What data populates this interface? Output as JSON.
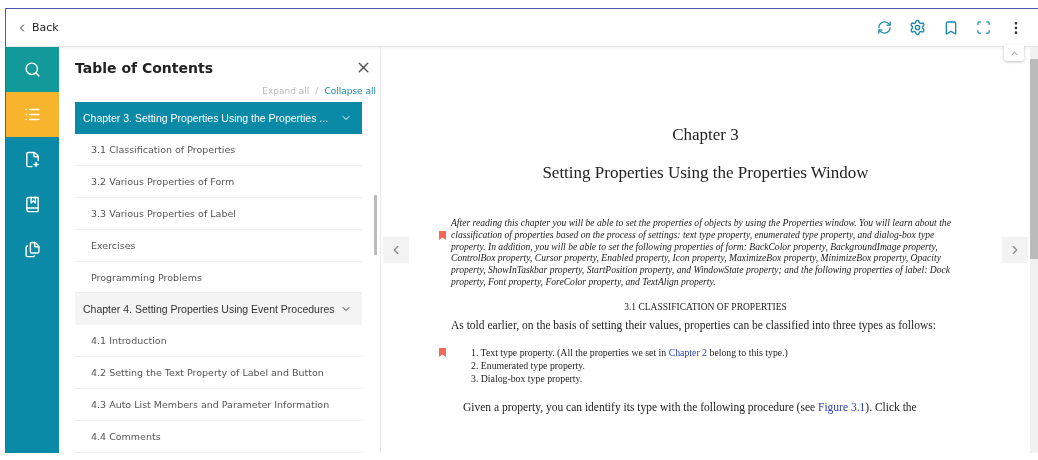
{
  "header": {
    "back": "Back"
  },
  "rail": [
    {
      "kind": "search",
      "selected": false
    },
    {
      "kind": "contents",
      "selected": true
    },
    {
      "kind": "notes",
      "selected": false
    },
    {
      "kind": "bookmarks",
      "selected": false
    },
    {
      "kind": "flashcards",
      "selected": false
    }
  ],
  "toc": {
    "title": "Table of Contents",
    "expand_all": "Expand all",
    "separator": "/",
    "collapse_all": "Collapse all",
    "chapters": [
      {
        "label": "Chapter 3. Setting Properties Using the Properties ...",
        "selected": true,
        "expanded": true,
        "children": [
          {
            "label": "3.1 Classification of Properties"
          },
          {
            "label": "3.2 Various Properties of Form"
          },
          {
            "label": "3.3 Various Properties of Label"
          },
          {
            "label": "Exercises"
          },
          {
            "label": "Programming Problems"
          }
        ]
      },
      {
        "label": "Chapter 4. Setting Properties Using Event Procedures",
        "selected": false,
        "expanded": true,
        "children": [
          {
            "label": "4.1 Introduction"
          },
          {
            "label": "4.2 Setting the Text Property of Label and Button"
          },
          {
            "label": "4.3 Auto List Members and Parameter Information"
          },
          {
            "label": "4.4 Comments"
          }
        ]
      }
    ]
  },
  "page": {
    "chapter": "Chapter 3",
    "title": "Setting Properties Using the Properties Window",
    "blocks": [
      {
        "kind": "abstract",
        "bookmarked": true,
        "parts": [
          {
            "text": "After reading this chapter you will be able to set the properties of objects by using the Properties window. You will learn about the classification of properties based on the process of settings: text type property, enumerated type property, and dialog-box type property. In addition, you will be able to set the following properties of form: BackColor property, BackgroundImage property, ControlBox property, Cursor property, Enabled property, Icon property, MaximizeBox property, MinimizeBox property, Opacity property, ShowInTaskbar property, StartPosition property, and WindowState property; and the following properties of label: Dock property, Font property, ForeColor property, and TextAlign property."
          }
        ]
      },
      {
        "kind": "heading",
        "bookmarked": false,
        "parts": [
          {
            "text": "3.1 CLASSIFICATION OF PROPERTIES"
          }
        ]
      },
      {
        "kind": "paragraph",
        "bookmarked": false,
        "parts": [
          {
            "text": "As told earlier, on the basis of setting their values, properties can be classified into three types as follows:"
          }
        ]
      },
      {
        "kind": "list",
        "bookmarked": true,
        "items": [
          [
            {
              "text": "1. Text type property. (All the properties we set in "
            },
            {
              "text": "Chapter 2",
              "link": true
            },
            {
              "text": " belong to this type.)"
            }
          ],
          [
            {
              "text": "2. Enumerated type property."
            }
          ],
          [
            {
              "text": "3. Dialog-box type property."
            }
          ]
        ]
      },
      {
        "kind": "indented",
        "bookmarked": false,
        "parts": [
          {
            "text": "Given a property, you can identify its type with the following procedure (see "
          },
          {
            "text": "Figure 3.1",
            "link": true
          },
          {
            "text": "). Click the"
          }
        ]
      }
    ]
  }
}
